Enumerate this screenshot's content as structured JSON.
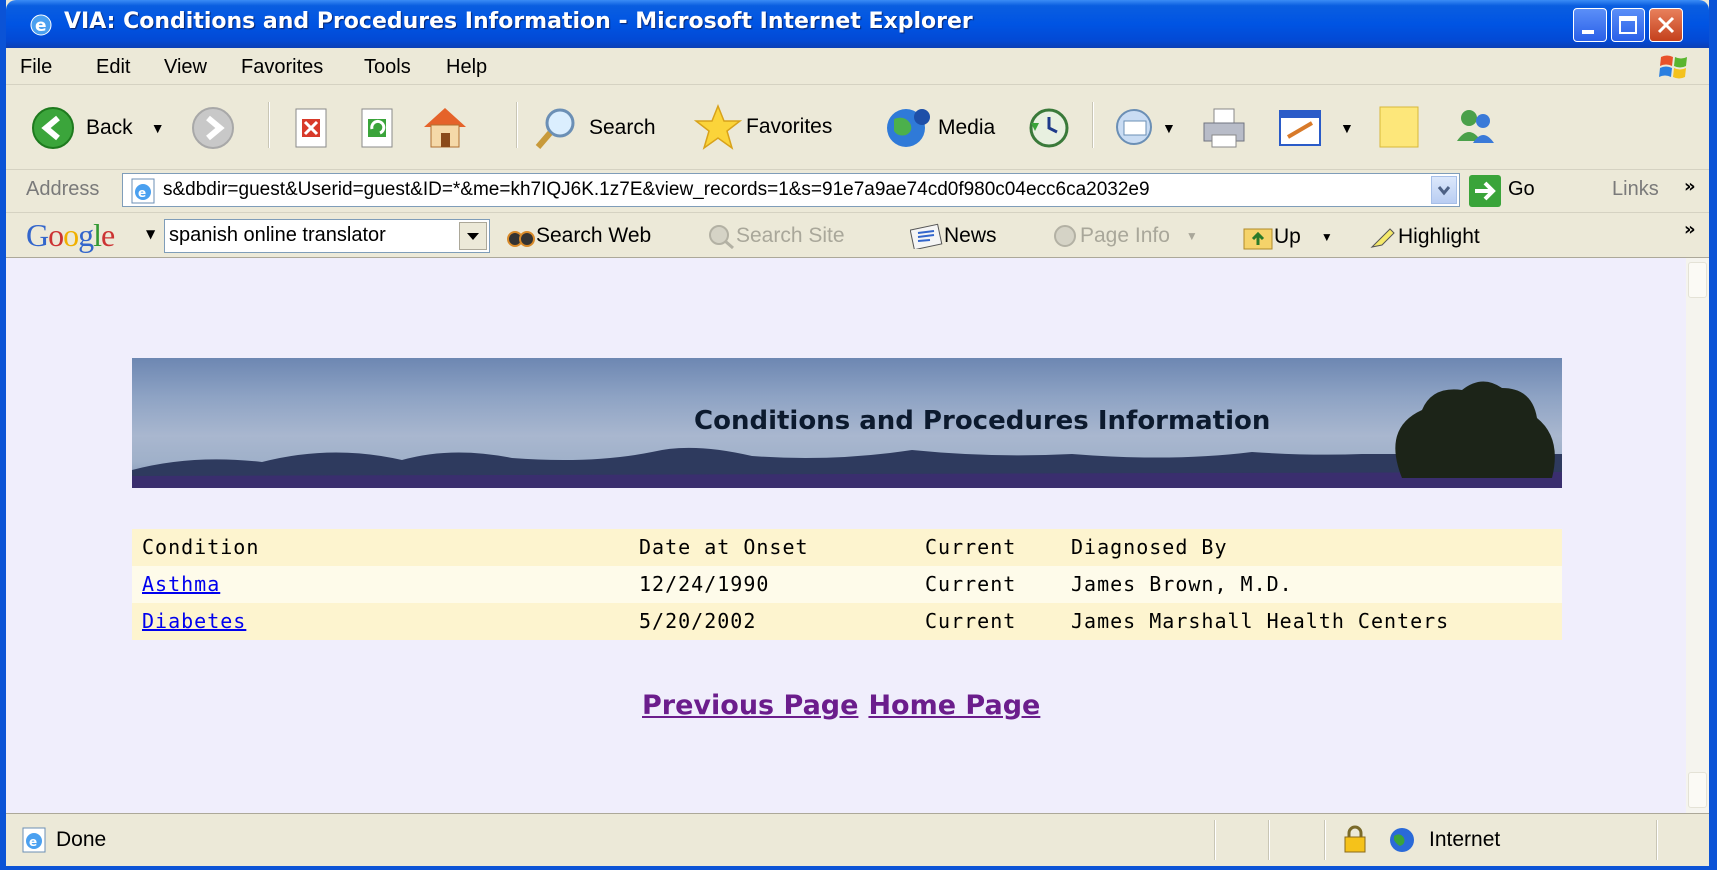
{
  "window": {
    "title": "VIA: Conditions and Procedures Information - Microsoft Internet Explorer"
  },
  "menu": {
    "items": [
      "File",
      "Edit",
      "View",
      "Favorites",
      "Tools",
      "Help"
    ]
  },
  "toolbar": {
    "back_label": "Back",
    "search_label": "Search",
    "favorites_label": "Favorites",
    "media_label": "Media"
  },
  "address": {
    "label": "Address",
    "url": "s&dbdir=guest&Userid=guest&ID=*&me=kh7IQJ6K.1z7E&view_records=1&s=91e7a9ae74cd0f980c04ecc6ca2032e9",
    "go_label": "Go",
    "links_label": "Links"
  },
  "google": {
    "logo": "Google",
    "query": "spanish online translator",
    "search_web": "Search Web",
    "search_site": "Search Site",
    "news": "News",
    "page_info": "Page Info",
    "up": "Up",
    "highlight": "Highlight"
  },
  "page": {
    "banner_title": "Conditions and Procedures Information",
    "table": {
      "headers": [
        "Condition",
        "Date at Onset",
        "Current",
        "Diagnosed By"
      ],
      "rows": [
        [
          "Asthma",
          "12/24/1990",
          "Current",
          "James Brown, M.D."
        ],
        [
          "Diabetes",
          "5/20/2002",
          "Current",
          "James Marshall Health Centers"
        ]
      ]
    },
    "links": {
      "previous": "Previous Page",
      "home": "Home Page"
    }
  },
  "status": {
    "text": "Done",
    "zone": "Internet"
  },
  "colors": {
    "titlebar": "#0054e3",
    "content_bg": "#f0eefc",
    "table_header_bg": "#fdf4cf",
    "link": "#0000ee",
    "visited_link": "#6b1d8c"
  }
}
